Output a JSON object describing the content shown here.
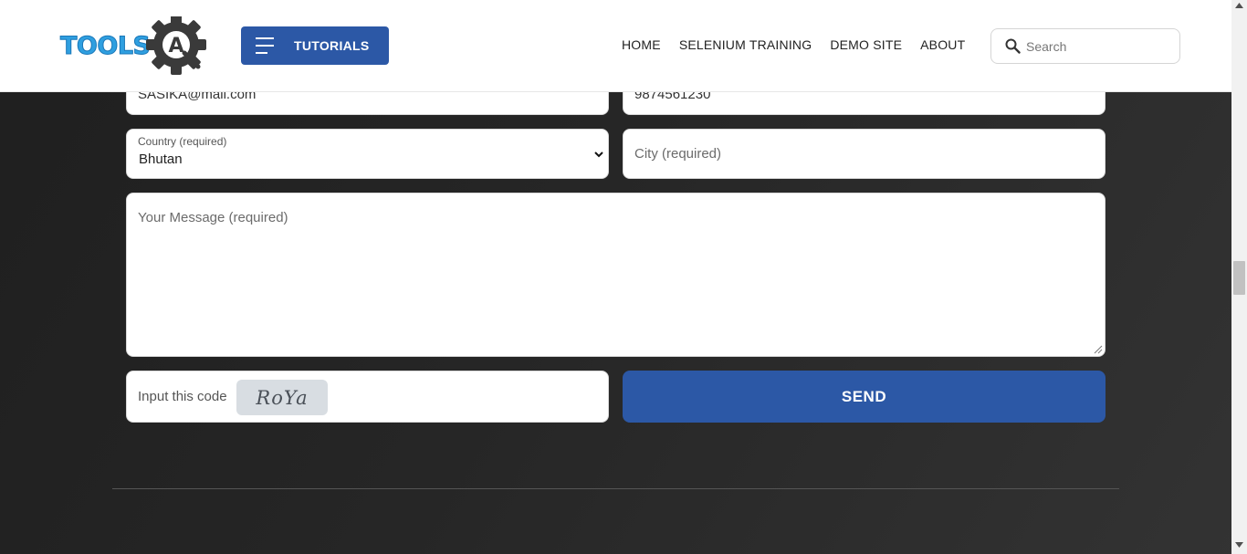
{
  "header": {
    "logo_text": "TOOLS",
    "logo_letter": "A",
    "tutorials_label": "TUTORIALS",
    "nav": [
      "HOME",
      "SELENIUM TRAINING",
      "DEMO SITE",
      "ABOUT"
    ],
    "search_placeholder": "Search"
  },
  "form": {
    "email_value": "SASIKA@mail.com",
    "phone_value": "9874561230",
    "country_label": "Country (required)",
    "country_value": "Bhutan",
    "city_placeholder": "City (required)",
    "message_placeholder": "Your Message (required)",
    "captcha_label": "Input this code",
    "captcha_code": "RoYa",
    "send_label": "SEND"
  },
  "colors": {
    "brand_blue": "#2c58a6",
    "logo_blue": "#2f9fe0",
    "page_dark": "#262626"
  },
  "icons": [
    "hamburger-icon",
    "search-icon",
    "chevron-down-icon",
    "gear-logo-icon",
    "resize-grip-icon",
    "scroll-up-icon",
    "scroll-down-icon"
  ]
}
